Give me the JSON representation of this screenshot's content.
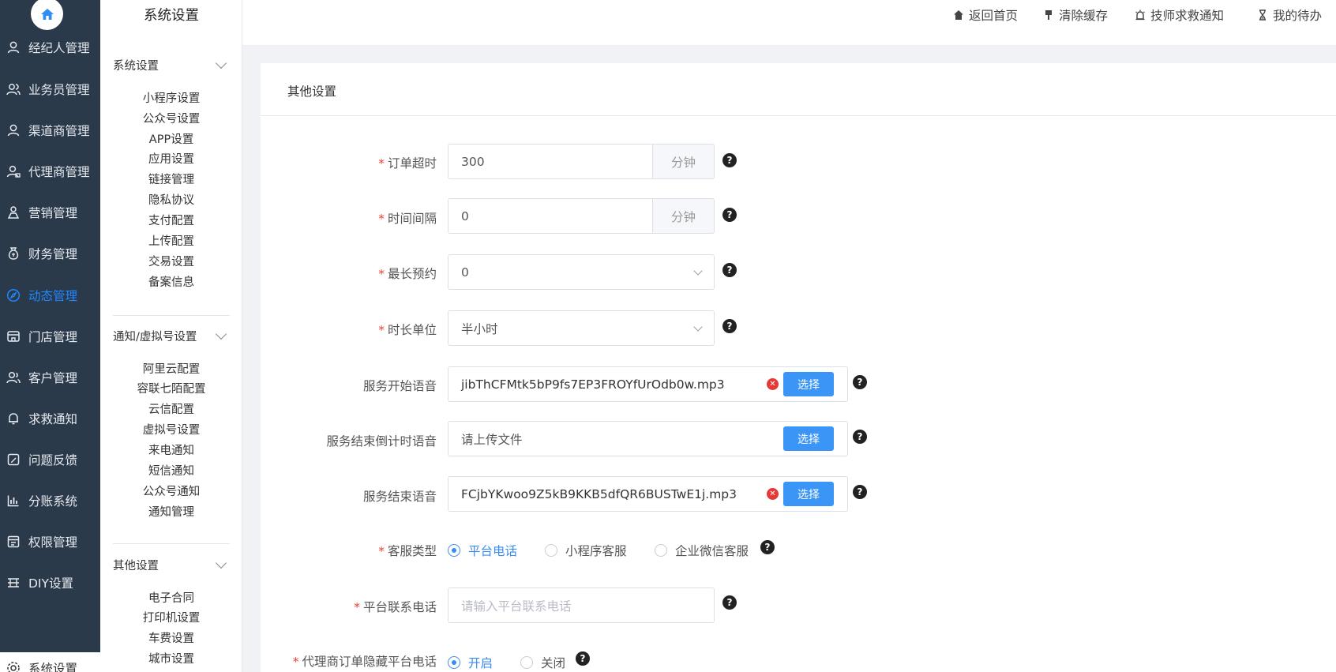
{
  "sidebar": {
    "items": [
      {
        "label": "经纪人管理",
        "icon": "user-icon"
      },
      {
        "label": "业务员管理",
        "icon": "users-icon"
      },
      {
        "label": "渠道商管理",
        "icon": "user-icon"
      },
      {
        "label": "代理商管理",
        "icon": "user-group-icon"
      },
      {
        "label": "营销管理",
        "icon": "megaphone-icon"
      },
      {
        "label": "财务管理",
        "icon": "money-bag-icon"
      },
      {
        "label": "动态管理",
        "icon": "compass-icon"
      },
      {
        "label": "门店管理",
        "icon": "store-icon"
      },
      {
        "label": "客户管理",
        "icon": "customers-icon"
      },
      {
        "label": "求救通知",
        "icon": "bell-icon"
      },
      {
        "label": "问题反馈",
        "icon": "feedback-icon"
      },
      {
        "label": "分账系统",
        "icon": "chart-icon"
      },
      {
        "label": "权限管理",
        "icon": "permission-icon"
      },
      {
        "label": "DIY设置",
        "icon": "diy-icon"
      },
      {
        "label": "系统设置",
        "icon": "settings-icon"
      }
    ]
  },
  "submenu": {
    "title": "系统设置",
    "groups": [
      {
        "title": "系统设置",
        "links": [
          "小程序设置",
          "公众号设置",
          "APP设置",
          "应用设置",
          "链接管理",
          "隐私协议",
          "支付配置",
          "上传配置",
          "交易设置",
          "备案信息"
        ]
      },
      {
        "title": "通知/虚拟号设置",
        "links": [
          "阿里云配置",
          "容联七陌配置",
          "云信配置",
          "虚拟号设置",
          "来电通知",
          "短信通知",
          "公众号通知",
          "通知管理"
        ]
      },
      {
        "title": "其他设置",
        "links": [
          "电子合同",
          "打印机设置",
          "车费设置",
          "城市设置"
        ]
      }
    ]
  },
  "header": {
    "links": [
      {
        "label": "返回首页",
        "icon": "home-icon"
      },
      {
        "label": "清除缓存",
        "icon": "brush-icon"
      },
      {
        "label": "技师求救通知",
        "icon": "alarm-icon"
      },
      {
        "label": "我的待办",
        "icon": "hourglass-icon"
      }
    ]
  },
  "form": {
    "card_title": "其他设置",
    "order_timeout": {
      "label": "订单超时",
      "value": "300",
      "suffix": "分钟"
    },
    "time_interval": {
      "label": "时间间隔",
      "value": "0",
      "suffix": "分钟"
    },
    "max_booking": {
      "label": "最长预约",
      "value": "0"
    },
    "duration_unit": {
      "label": "时长单位",
      "value": "半小时"
    },
    "service_start_voice": {
      "label": "服务开始语音",
      "value": "jibThCFMtk5bP9fs7EP3FROYfUrOdb0w.mp3",
      "button": "选择"
    },
    "service_countdown_voice": {
      "label": "服务结束倒计时语音",
      "placeholder": "请上传文件",
      "button": "选择"
    },
    "service_end_voice": {
      "label": "服务结束语音",
      "value": "FCjbYKwoo9Z5kB9KKB5dfQR6BUSTwE1j.mp3",
      "button": "选择"
    },
    "service_type": {
      "label": "客服类型",
      "options": [
        "平台电话",
        "小程序客服",
        "企业微信客服"
      ],
      "selected": "平台电话"
    },
    "platform_phone": {
      "label": "平台联系电话",
      "placeholder": "请输入平台联系电话"
    },
    "hide_phone": {
      "label": "代理商订单隐藏平台电话",
      "options": [
        "开启",
        "关闭"
      ],
      "selected": "开启"
    }
  },
  "colors": {
    "sidebar_bg": "#2b3a4a",
    "accent": "#3b8cf0",
    "button": "#3b95f7",
    "required": "#f04134"
  }
}
